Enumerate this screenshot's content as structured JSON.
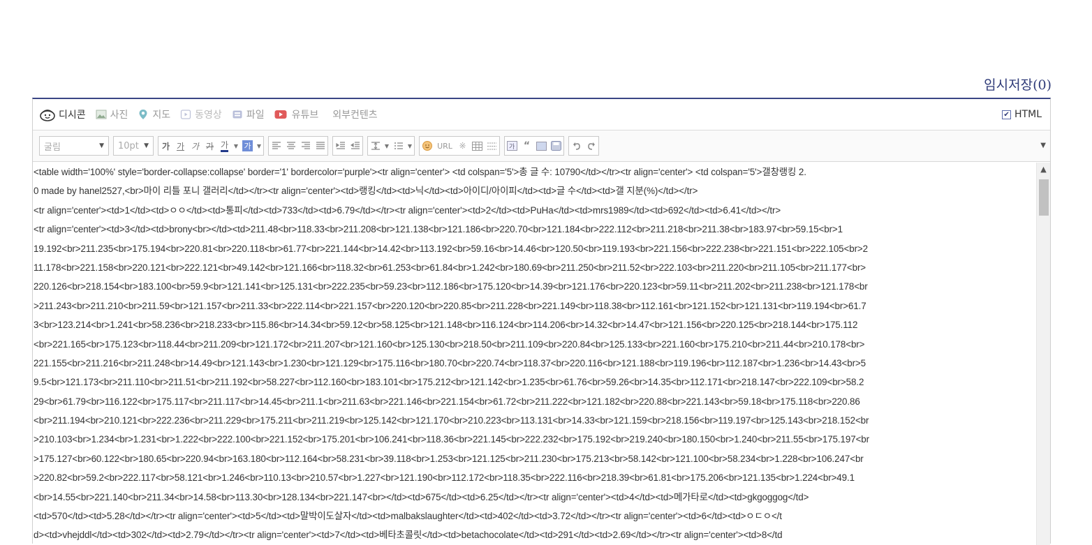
{
  "temp_save": "임시저장(0)",
  "tabs": [
    {
      "label": "디시콘",
      "icon": "smile-icon",
      "active": true
    },
    {
      "label": "사진",
      "icon": "image-icon",
      "active": false
    },
    {
      "label": "지도",
      "icon": "map-pin-icon",
      "active": false
    },
    {
      "label": "동영상",
      "icon": "video-icon",
      "active": false
    },
    {
      "label": "파일",
      "icon": "file-icon",
      "active": false
    },
    {
      "label": "유튜브",
      "icon": "youtube-icon",
      "active": false
    },
    {
      "label": "외부컨텐츠",
      "icon": "",
      "active": false
    }
  ],
  "html_toggle": {
    "label": "HTML",
    "checked": true
  },
  "toolbar": {
    "font_family": "굴림",
    "font_size": "10pt",
    "bold": "가",
    "underline": "가",
    "italic": "가",
    "strike": "가",
    "font_color": "가",
    "bg_color": "가",
    "url_label": "URL"
  },
  "content_lines": [
    "<table width='100%' style='border-collapse:collapse' border='1' bordercolor='purple'><tr align='center'> <td colspan='5'>총 글 수: 10790</td></tr><tr align='center'> <td colspan='5'>갤창랭킹 2.",
    "0 made by hanel2527,<br>마이 리틀 포니 갤러리</td></tr><tr align='center'><td>랭킹</td><td>닉</td><td>아이디/아이피</td><td>글 수</td><td>갤 지분(%)</td></tr>",
    "<tr align='center'><td>1</td><td>ㅇㅇ</td><td>통피</td><td>733</td><td>6.79</td></tr><tr align='center'><td>2</td><td>PuHa</td><td>mrs1989</td><td>692</td><td>6.41</td></tr>",
    "<tr align='center'><td>3</td><td>brony<br></td><td>211.48<br>118.33<br>211.208<br>121.138<br>121.186<br>220.70<br>121.184<br>222.112<br>211.218<br>211.38<br>183.97<br>59.15<br>1",
    "19.192<br>211.235<br>175.194<br>220.81<br>220.118<br>61.77<br>221.144<br>14.42<br>113.192<br>59.16<br>14.46<br>120.50<br>119.193<br>221.156<br>222.238<br>221.151<br>222.105<br>2",
    "11.178<br>221.158<br>220.121<br>222.121<br>49.142<br>121.166<br>118.32<br>61.253<br>61.84<br>1.242<br>180.69<br>211.250<br>211.52<br>222.103<br>211.220<br>211.105<br>211.177<br>",
    "220.126<br>218.154<br>183.100<br>59.9<br>121.141<br>125.131<br>222.235<br>59.23<br>112.186<br>175.120<br>14.39<br>121.176<br>220.123<br>59.11<br>211.202<br>211.238<br>121.178<br",
    ">211.243<br>211.210<br>211.59<br>121.157<br>211.33<br>222.114<br>221.157<br>220.120<br>220.85<br>211.228<br>221.149<br>118.38<br>112.161<br>121.152<br>121.131<br>119.194<br>61.7",
    "3<br>123.214<br>1.241<br>58.236<br>218.233<br>115.86<br>14.34<br>59.12<br>58.125<br>121.148<br>116.124<br>114.206<br>14.32<br>14.47<br>121.156<br>220.125<br>218.144<br>175.112",
    "<br>221.165<br>175.123<br>118.44<br>211.209<br>121.172<br>211.207<br>121.160<br>125.130<br>218.50<br>211.109<br>220.84<br>125.133<br>221.160<br>175.210<br>211.44<br>210.178<br>",
    "221.155<br>211.216<br>211.248<br>14.49<br>121.143<br>1.230<br>121.129<br>175.116<br>180.70<br>220.74<br>118.37<br>220.116<br>121.188<br>119.196<br>112.187<br>1.236<br>14.43<br>5",
    "9.5<br>121.173<br>211.110<br>211.51<br>211.192<br>58.227<br>112.160<br>183.101<br>175.212<br>121.142<br>1.235<br>61.76<br>59.26<br>14.35<br>112.171<br>218.147<br>222.109<br>58.2",
    "29<br>61.79<br>116.122<br>175.117<br>211.117<br>14.45<br>211.1<br>211.63<br>221.146<br>221.154<br>61.72<br>211.222<br>121.182<br>220.88<br>221.143<br>59.18<br>175.118<br>220.86",
    "<br>211.194<br>210.121<br>222.236<br>211.229<br>175.211<br>211.219<br>125.142<br>121.170<br>210.223<br>113.131<br>14.33<br>121.159<br>218.156<br>119.197<br>125.143<br>218.152<br",
    ">210.103<br>1.234<br>1.231<br>1.222<br>222.100<br>221.152<br>175.201<br>106.241<br>118.36<br>221.145<br>222.232<br>175.192<br>219.240<br>180.150<br>1.240<br>211.55<br>175.197<br",
    ">175.127<br>60.122<br>180.65<br>220.94<br>163.180<br>112.164<br>58.231<br>39.118<br>1.253<br>121.125<br>211.230<br>175.213<br>58.142<br>121.100<br>58.234<br>1.228<br>106.247<br",
    ">220.82<br>59.2<br>222.117<br>58.121<br>1.246<br>110.13<br>210.57<br>1.227<br>121.190<br>112.172<br>118.35<br>222.116<br>218.39<br>61.81<br>175.206<br>121.135<br>1.224<br>49.1",
    "<br>14.55<br>221.140<br>211.34<br>14.58<br>113.30<br>128.134<br>221.147<br></td><td>675</td><td>6.25</td></tr><tr align='center'><td>4</td><td>메가타로</td><td>gkgoggog</td>",
    "<td>570</td><td>5.28</td></tr><tr align='center'><td>5</td><td>말박이도살자</td><td>malbakslaughter</td><td>402</td><td>3.72</td></tr><tr align='center'><td>6</td><td>ㅇㄷㅇ</t",
    "d><td>vhejddl</td><td>302</td><td>2.79</td></tr><tr align='center'><td>7</td><td>베타초콜릿</td><td>betachocolate</td><td>291</td><td>2.69</td></tr><tr align='center'><td>8</td"
  ]
}
